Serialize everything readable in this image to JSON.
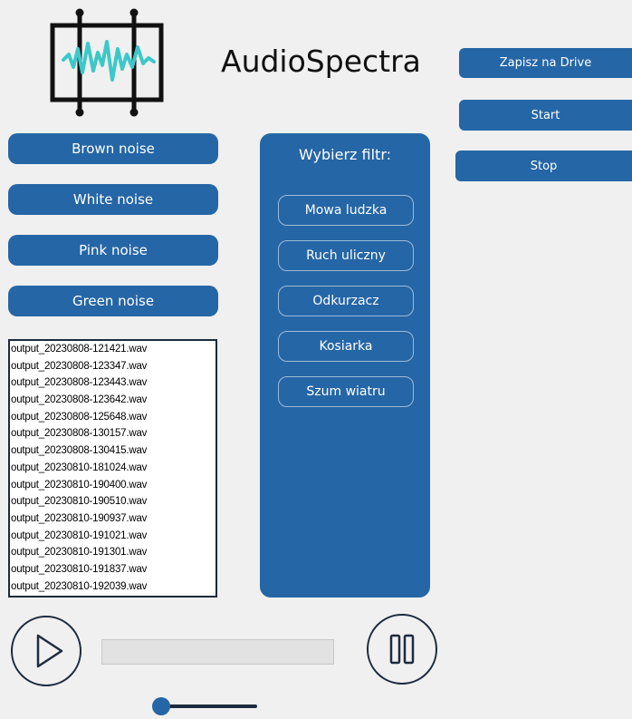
{
  "app": {
    "title": "AudioSpectra"
  },
  "noise_buttons": [
    "Brown noise",
    "White noise",
    "Pink noise",
    "Green noise"
  ],
  "actions": {
    "save_drive": "Zapisz na Drive",
    "start": "Start",
    "stop": "Stop"
  },
  "filter": {
    "title": "Wybierz filtr:",
    "options": [
      "Mowa ludzka",
      "Ruch uliczny",
      "Odkurzacz",
      "Kosiarka",
      "Szum wiatru"
    ]
  },
  "files": [
    "output_20230808-121421.wav",
    "output_20230808-123347.wav",
    "output_20230808-123443.wav",
    "output_20230808-123642.wav",
    "output_20230808-125648.wav",
    "output_20230808-130157.wav",
    "output_20230808-130415.wav",
    "output_20230810-181024.wav",
    "output_20230810-190400.wav",
    "output_20230810-190510.wav",
    "output_20230810-190937.wav",
    "output_20230810-191021.wav",
    "output_20230810-191301.wav",
    "output_20230810-191837.wav",
    "output_20230810-192039.wav"
  ],
  "player": {
    "progress": 0,
    "volume": 0
  },
  "colors": {
    "accent": "#2566a6",
    "background": "#f0f0f0",
    "waveform": "#3cc8c8",
    "dark": "#1d2b3f"
  },
  "icons": {
    "logo": "waveform-logo-icon",
    "play": "play-icon",
    "pause": "pause-icon"
  }
}
